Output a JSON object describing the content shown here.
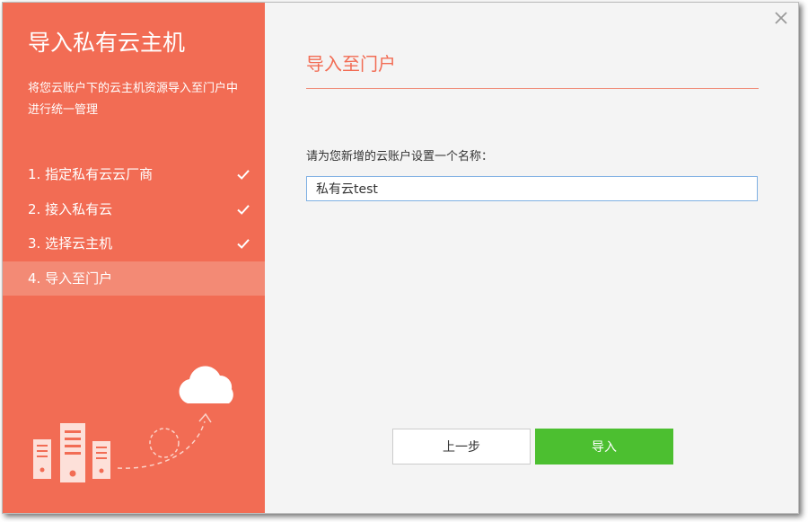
{
  "sidebar": {
    "title": "导入私有云主机",
    "description": "将您云账户下的云主机资源导入至门户中进行统一管理",
    "steps": [
      {
        "label": "1. 指定私有云云厂商",
        "done": true
      },
      {
        "label": "2. 接入私有云",
        "done": true
      },
      {
        "label": "3. 选择云主机",
        "done": true
      },
      {
        "label": "4. 导入至门户",
        "done": false,
        "active": true
      }
    ]
  },
  "main": {
    "section_title": "导入至门户",
    "field_label": "请为您新增的云账户设置一个名称：",
    "name_value": "私有云test"
  },
  "buttons": {
    "prev_label": "上一步",
    "import_label": "导入"
  },
  "icons": {
    "close": "close-icon",
    "check": "check-icon",
    "cloud": "cloud-icon",
    "server": "server-icon"
  },
  "colors": {
    "accent": "#f26c54",
    "active_step": "#f38a75",
    "primary_button": "#4cbf30",
    "input_border": "#7fb0e3"
  }
}
